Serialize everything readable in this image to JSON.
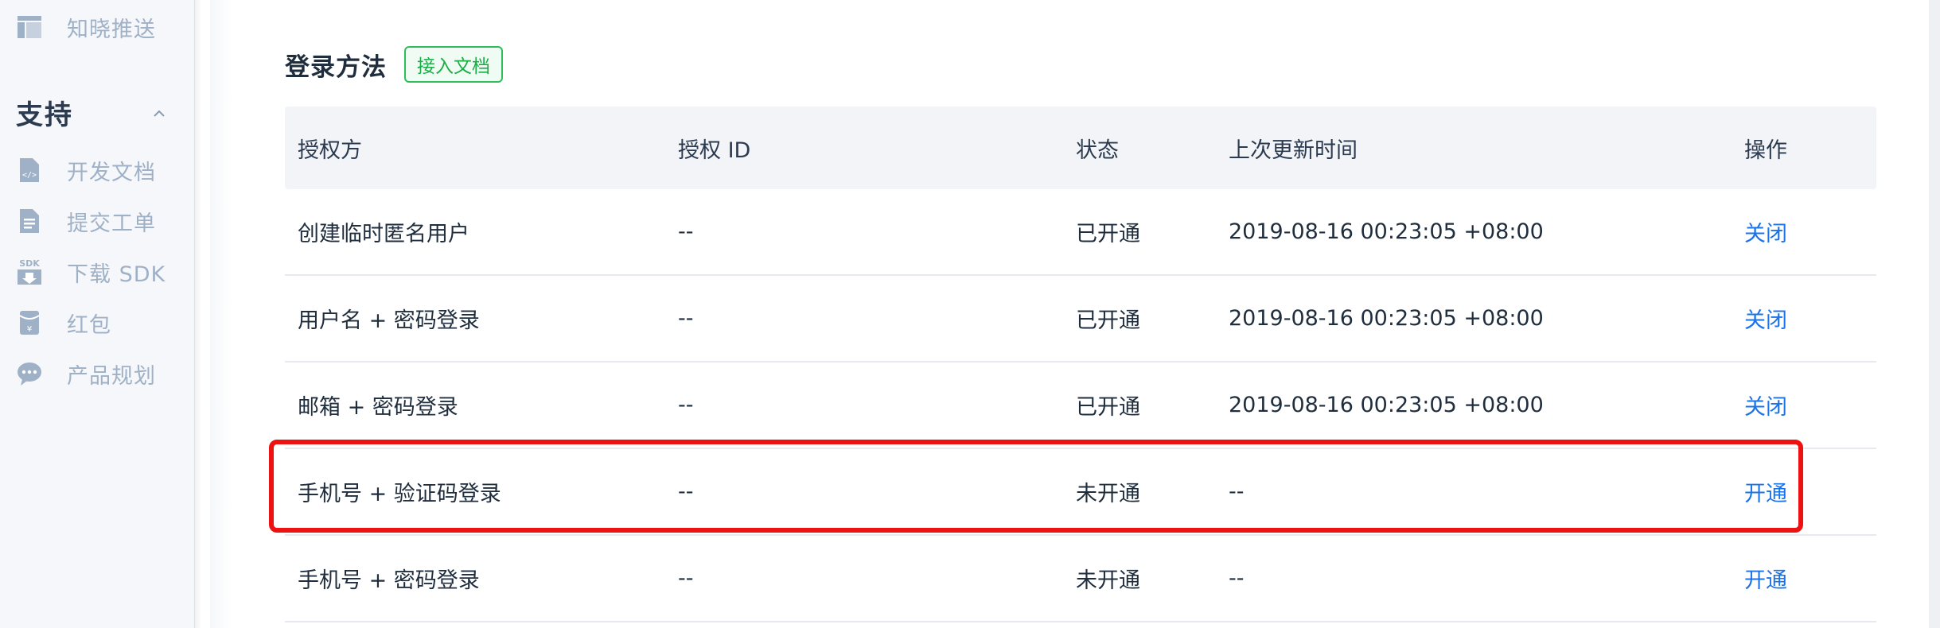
{
  "sidebar": {
    "top_item": {
      "label": "知晓推送",
      "icon": "layout-icon"
    },
    "section": {
      "title": "支持",
      "chevron": "^"
    },
    "items": [
      {
        "label": "开发文档",
        "icon": "code-doc-icon"
      },
      {
        "label": "提交工单",
        "icon": "document-icon"
      },
      {
        "label": "下载 SDK",
        "icon": "sdk-download-icon"
      },
      {
        "label": "红包",
        "icon": "red-packet-icon"
      },
      {
        "label": "产品规划",
        "icon": "chat-bubble-icon"
      }
    ]
  },
  "main": {
    "title": "登录方法",
    "doc_tag": "接入文档",
    "table": {
      "headers": [
        "授权方",
        "授权 ID",
        "状态",
        "上次更新时间",
        "操作"
      ],
      "rows": [
        {
          "provider": "创建临时匿名用户",
          "auth_id": "--",
          "status": "已开通",
          "updated": "2019-08-16 00:23:05 +08:00",
          "action": "关闭"
        },
        {
          "provider": "用户名 + 密码登录",
          "auth_id": "--",
          "status": "已开通",
          "updated": "2019-08-16 00:23:05 +08:00",
          "action": "关闭"
        },
        {
          "provider": "邮箱 + 密码登录",
          "auth_id": "--",
          "status": "已开通",
          "updated": "2019-08-16 00:23:05 +08:00",
          "action": "关闭"
        },
        {
          "provider": "手机号 + 验证码登录",
          "auth_id": "--",
          "status": "未开通",
          "updated": "--",
          "action": "开通"
        },
        {
          "provider": "手机号 + 密码登录",
          "auth_id": "--",
          "status": "未开通",
          "updated": "--",
          "action": "开通"
        }
      ]
    }
  },
  "colors": {
    "accent_link": "#1a73e8",
    "tag_green": "#1aad47",
    "highlight_red": "#ee1111",
    "sidebar_text": "#9fb1c6"
  }
}
